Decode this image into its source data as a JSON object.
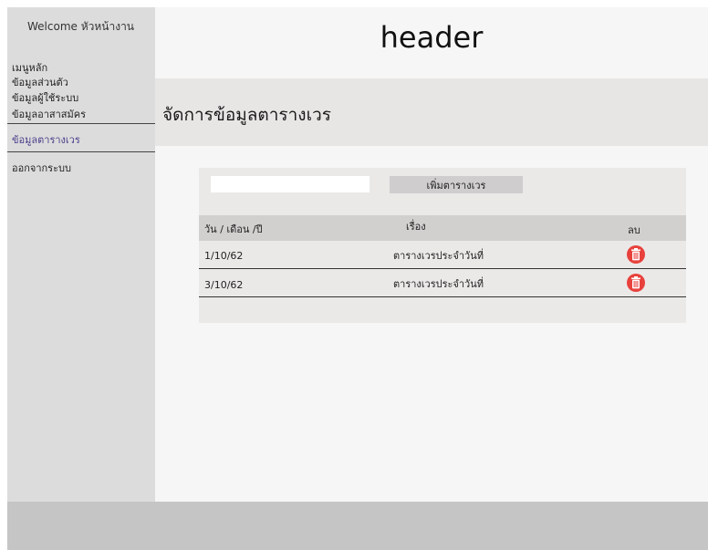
{
  "sidebar": {
    "welcome": "Welcome หัวหน้างาน",
    "items": [
      {
        "label": "เมนูหลัก"
      },
      {
        "label": "ข้อมูลส่วนตัว"
      },
      {
        "label": "ข้อมูลผู้ใช้ระบบ"
      },
      {
        "label": "ข้อมูลอาสาสมัคร"
      },
      {
        "label": "ข้อมูลตารางเวร",
        "active": true
      },
      {
        "label": "ออกจากระบบ"
      }
    ]
  },
  "header": {
    "title": "header"
  },
  "page": {
    "title": "จัดการข้อมูลตารางเวร"
  },
  "toolbar": {
    "search_value": "",
    "add_label": "เพิ่มตารางเวร"
  },
  "table": {
    "columns": [
      "วัน / เดือน /ปี",
      "เรื่อง",
      "ลบ"
    ],
    "rows": [
      {
        "date": "1/10/62",
        "subject": "ตารางเวรประจำวันที่"
      },
      {
        "date": "3/10/62",
        "subject": "ตารางเวรประจำวันที่"
      }
    ]
  },
  "icons": {
    "delete": "trash-icon"
  },
  "colors": {
    "sidebar_bg": "#dcdcdc",
    "active_menu": "#4b3f8c",
    "delete_button": "#e8413c",
    "footer_bg": "#c5c5c5"
  }
}
